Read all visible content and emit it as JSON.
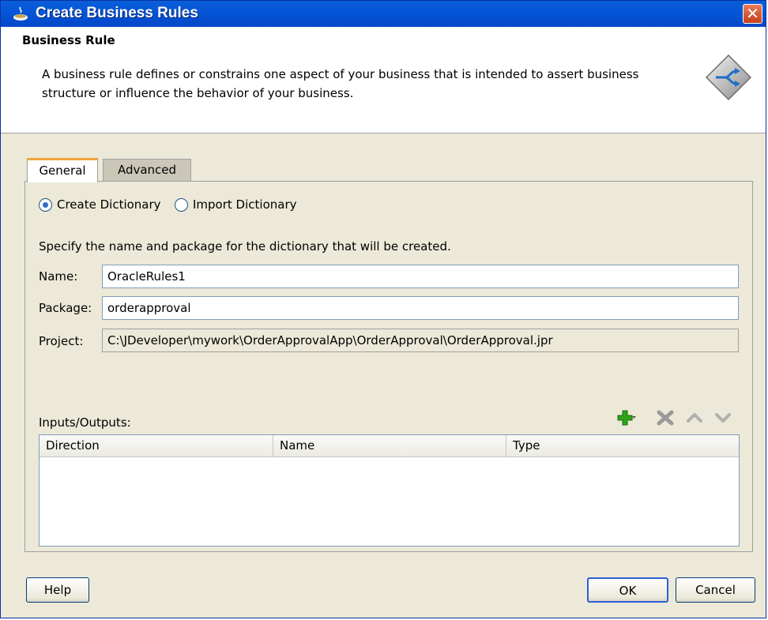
{
  "window": {
    "title": "Create Business Rules",
    "close_label": "✕"
  },
  "header": {
    "title": "Business Rule",
    "description": "A business rule defines or constrains one aspect of your business that is intended to assert business structure or influence the behavior of your business."
  },
  "tabs": [
    {
      "label": "General",
      "active": true
    },
    {
      "label": "Advanced",
      "active": false
    }
  ],
  "mode": {
    "create_label": "Create Dictionary",
    "import_label": "Import Dictionary",
    "selected": "Create Dictionary"
  },
  "form": {
    "instruction": "Specify the name and package for the dictionary that will be created.",
    "name_label": "Name:",
    "name_value": "OracleRules1",
    "package_label": "Package:",
    "package_value": "orderapproval",
    "project_label": "Project:",
    "project_value": "C:\\JDeveloper\\mywork\\OrderApprovalApp\\OrderApproval\\OrderApproval.jpr"
  },
  "io": {
    "label": "Inputs/Outputs:",
    "columns": [
      "Direction",
      "Name",
      "Type"
    ],
    "rows": []
  },
  "buttons": {
    "help": "Help",
    "ok": "OK",
    "cancel": "Cancel"
  },
  "colors": {
    "title_bar": "#0556d8",
    "tab_accent": "#f2a33a",
    "add_icon": "#2fa318"
  }
}
